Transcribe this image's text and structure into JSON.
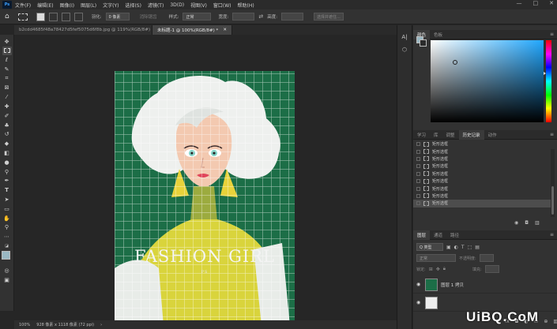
{
  "menubar": {
    "logo": "Ps",
    "items": [
      "文件(F)",
      "编辑(E)",
      "图像(I)",
      "图层(L)",
      "文字(Y)",
      "选择(S)",
      "滤镜(T)",
      "3D(D)",
      "视图(V)",
      "窗口(W)",
      "帮助(H)"
    ],
    "controls": [
      "—",
      "□",
      "✕"
    ]
  },
  "options": {
    "feather_label": "羽化:",
    "feather_value": "0 像素",
    "antialias_label": "消除锯齿",
    "style_label": "样式:",
    "style_value": "正常",
    "width_label": "宽度:",
    "height_label": "高度:",
    "mask_button": "选择并遮住..."
  },
  "tabs": [
    {
      "label": "b2cdd4685f48a78427d5fef5075d6f8b.jpg @ 119%(RGB/8#)",
      "close": "✕"
    },
    {
      "label": "未标题-1 @ 100%(RGB/8#) *",
      "close": "✕"
    }
  ],
  "document": {
    "title_text": "FASHION GIRL",
    "subtitle_text": "PS"
  },
  "status": {
    "zoom": "100%",
    "dims": "928 像素 x 1118 像素 (72 ppi)",
    "arrow": "›"
  },
  "color_panel": {
    "tabs": [
      "颜色",
      "色板"
    ],
    "menu": "≡"
  },
  "history_panel": {
    "tabs": [
      "学习",
      "库",
      "调整",
      "历史记录",
      "动作"
    ],
    "menu": "≡",
    "items": [
      "矩形选框",
      "矩形选框",
      "矩形选框",
      "矩形选框",
      "矩形选框",
      "矩形选框",
      "矩形选框",
      "矩形选框",
      "矩形选框"
    ]
  },
  "layers_panel": {
    "tabs": [
      "图层",
      "通道",
      "路径"
    ],
    "menu": "≡",
    "filter_value": "Q 类型",
    "blend_value": "正常",
    "opacity_label": "不透明度:",
    "lock_label": "锁定:",
    "fill_label": "填充:",
    "layers": [
      "图层 1 拷贝"
    ]
  },
  "watermark": "UiBQ.CoM"
}
